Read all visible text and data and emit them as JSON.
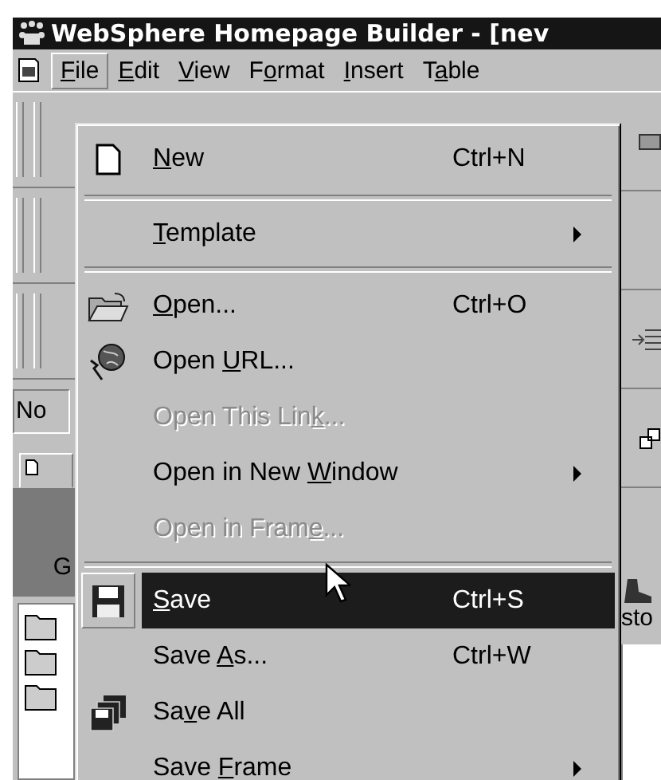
{
  "window": {
    "title": "WebSphere Homepage Builder - [nev"
  },
  "menubar": [
    {
      "key": "F",
      "post": "ile",
      "selected": true
    },
    {
      "key": "E",
      "post": "dit",
      "selected": false
    },
    {
      "key": "V",
      "post": "iew",
      "selected": false
    },
    {
      "pre": "F",
      "key": "o",
      "post": "rmat",
      "selected": false
    },
    {
      "key": "I",
      "post": "nsert",
      "selected": false
    },
    {
      "pre": "T",
      "key": "a",
      "post": "ble",
      "selected": false
    }
  ],
  "background": {
    "field_value": "No",
    "left_panel_text": "G",
    "right_panel_text": "sto"
  },
  "file_menu": [
    {
      "kind": "item",
      "key": "N",
      "post": "ew",
      "shortcut": "Ctrl+N",
      "submenu": false,
      "disabled": false,
      "selected": false
    },
    {
      "kind": "separator"
    },
    {
      "kind": "item",
      "key": "T",
      "post": "emplate",
      "submenu": true,
      "disabled": false,
      "selected": false
    },
    {
      "kind": "separator"
    },
    {
      "kind": "item",
      "key": "O",
      "post": "pen...",
      "shortcut": "Ctrl+O",
      "submenu": false,
      "disabled": false,
      "selected": false
    },
    {
      "kind": "item",
      "pre": "Open ",
      "key": "U",
      "post": "RL...",
      "submenu": false,
      "disabled": false,
      "selected": false
    },
    {
      "kind": "item",
      "pre": "Open This Lin",
      "key": "k",
      "post": "...",
      "submenu": false,
      "disabled": true,
      "selected": false
    },
    {
      "kind": "item",
      "pre": "Open in New ",
      "key": "W",
      "post": "indow",
      "submenu": true,
      "disabled": false,
      "selected": false
    },
    {
      "kind": "item",
      "pre": "Open in Fram",
      "key": "e",
      "post": "...",
      "submenu": false,
      "disabled": true,
      "selected": false
    },
    {
      "kind": "separator"
    },
    {
      "kind": "item",
      "key": "S",
      "post": "ave",
      "shortcut": "Ctrl+S",
      "submenu": false,
      "disabled": false,
      "selected": true
    },
    {
      "kind": "item",
      "pre": "Save ",
      "key": "A",
      "post": "s...",
      "shortcut": "Ctrl+W",
      "submenu": false,
      "disabled": false,
      "selected": false
    },
    {
      "kind": "item",
      "pre": "Sa",
      "key": "v",
      "post": "e All",
      "submenu": false,
      "disabled": false,
      "selected": false
    },
    {
      "kind": "item",
      "pre": "Save ",
      "key": "F",
      "post": "rame",
      "submenu": true,
      "disabled": false,
      "selected": false
    }
  ]
}
